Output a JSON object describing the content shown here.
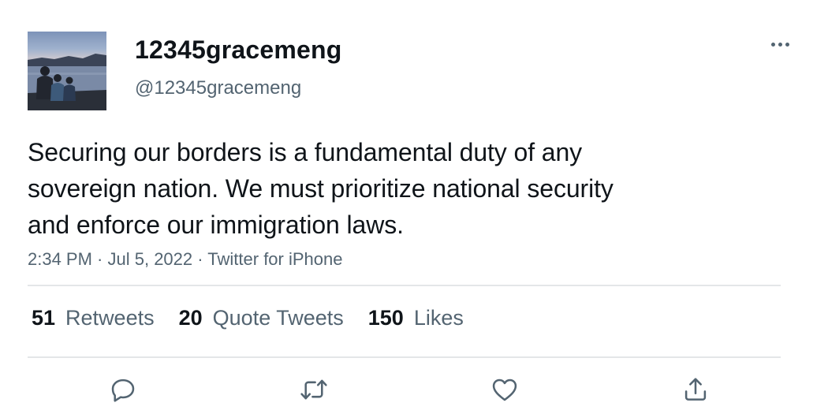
{
  "user": {
    "display_name": "12345gracemeng",
    "handle": "@12345gracemeng",
    "avatar_icon": "profile-photo-lakeside"
  },
  "tweet": {
    "text_lines": [
      "Securing our borders is a fundamental duty of any",
      "sovereign nation. We must prioritize national security",
      "and enforce our immigration laws."
    ],
    "time": "2:34 PM",
    "separator": " · ",
    "date": "Jul 5, 2022",
    "source": "Twitter for iPhone"
  },
  "stats": {
    "retweets": {
      "count": "51",
      "label": "Retweets"
    },
    "quotes": {
      "count": "20",
      "label": "Quote Tweets"
    },
    "likes": {
      "count": "150",
      "label": "Likes"
    }
  },
  "actions": {
    "reply_icon": "reply-icon",
    "retweet_icon": "retweet-icon",
    "like_icon": "heart-icon",
    "share_icon": "share-icon"
  },
  "colors": {
    "text_primary": "#0f1419",
    "text_secondary": "#536471",
    "divider": "#e4e6e8",
    "background": "#ffffff"
  }
}
